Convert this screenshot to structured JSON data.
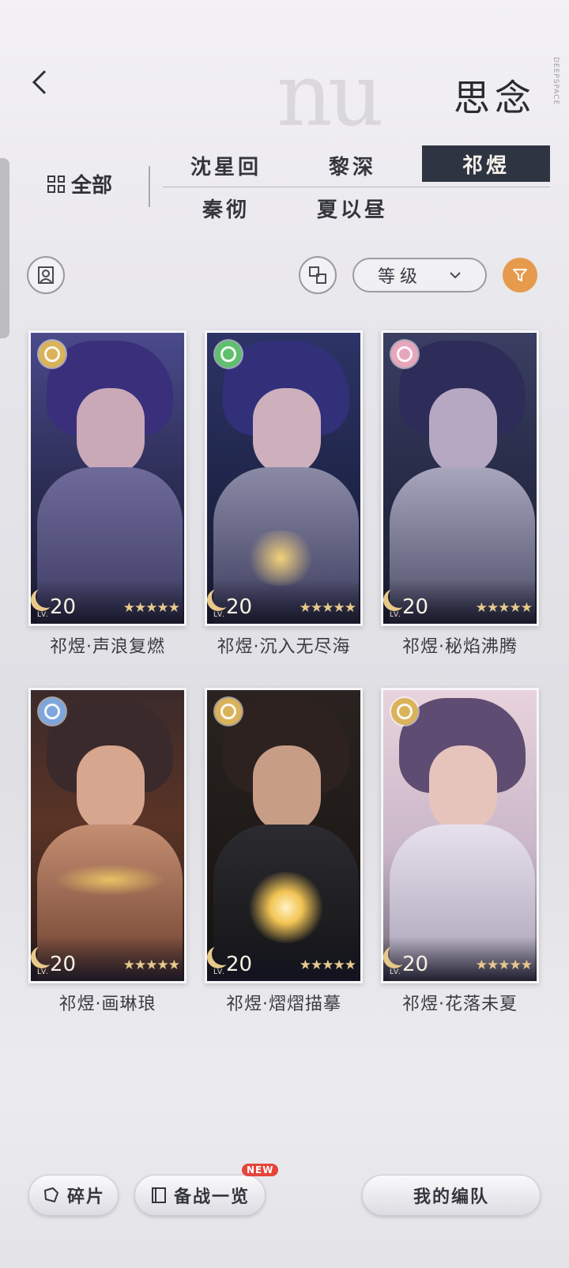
{
  "header": {
    "title": "思念",
    "brand_vertical": "DEEPSPACE"
  },
  "filters": {
    "all_label": "全部",
    "characters": [
      "沈星回",
      "黎深",
      "祁煜",
      "秦彻",
      "夏以昼"
    ],
    "active_character": "祁煜"
  },
  "toolbar": {
    "sort_label": "等级"
  },
  "cards": [
    {
      "name": "祁煜·声浪复燃",
      "level_prefix": "LV.",
      "level": "20",
      "stars": "★★★★★",
      "rarity_color": "#d9b25a"
    },
    {
      "name": "祁煜·沉入无尽海",
      "level_prefix": "LV.",
      "level": "20",
      "stars": "★★★★★",
      "rarity_color": "#5fbf6e"
    },
    {
      "name": "祁煜·秘焰沸腾",
      "level_prefix": "LV.",
      "level": "20",
      "stars": "★★★★★",
      "rarity_color": "#e6a6bd"
    },
    {
      "name": "祁煜·画琳琅",
      "level_prefix": "LV.",
      "level": "20",
      "stars": "★★★★★",
      "rarity_color": "#7fa6dc"
    },
    {
      "name": "祁煜·熠熠描摹",
      "level_prefix": "LV.",
      "level": "20",
      "stars": "★★★★★",
      "rarity_color": "#d9b25a"
    },
    {
      "name": "祁煜·花落未夏",
      "level_prefix": "LV.",
      "level": "20",
      "stars": "★★★★★",
      "rarity_color": "#d9b25a"
    }
  ],
  "bottom": {
    "fragments_label": "碎片",
    "prep_label": "备战一览",
    "new_badge": "NEW",
    "team_label": "我的编队"
  }
}
